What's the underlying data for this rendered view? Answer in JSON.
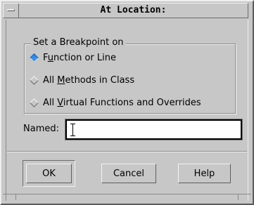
{
  "window": {
    "title": "At Location:"
  },
  "group": {
    "title": "Set a Breakpoint on",
    "options": [
      {
        "pre": "F",
        "mnemonic": "u",
        "post": "nction or Line",
        "selected": true
      },
      {
        "pre": "All ",
        "mnemonic": "M",
        "post": "ethods in Class",
        "selected": false
      },
      {
        "pre": "All ",
        "mnemonic": "V",
        "post": "irtual Functions and Overrides",
        "selected": false
      }
    ]
  },
  "named": {
    "label": "Named:",
    "value": ""
  },
  "buttons": {
    "ok": "OK",
    "cancel": "Cancel",
    "help": "Help"
  },
  "colors": {
    "selected_radio": "#3a8de0",
    "background": "#c7c7c7"
  }
}
